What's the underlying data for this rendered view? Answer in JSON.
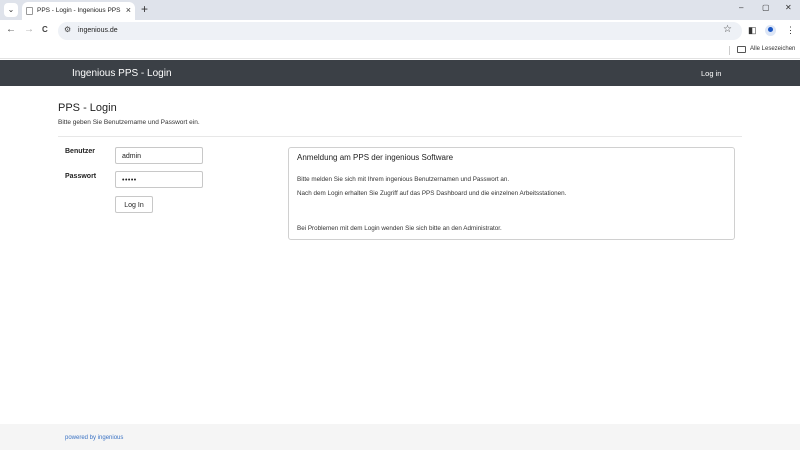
{
  "browser": {
    "tab_title": "PPS - Login - Ingenious PPS",
    "tab_menu_glyph": "⌄",
    "tab_close_glyph": "×",
    "new_tab_glyph": "+",
    "url": "ingenious.de",
    "bookmark_folder_label": "Alle Lesezeichen",
    "icons": {
      "back": "←",
      "forward": "→",
      "reload": "C",
      "site_info": "⚙",
      "star": "☆",
      "sidepanel": "◧",
      "menu": "⋮",
      "minimize": "–",
      "restore": "▢",
      "close": "✕"
    }
  },
  "navbar": {
    "brand": "Ingenious PPS - Login",
    "login_link": "Log in",
    "background": "#3b4046"
  },
  "login": {
    "title": "PPS - Login",
    "subtitle": "Bitte geben Sie Benutzername und Passwort ein.",
    "username_label": "Benutzer",
    "username_value": "admin",
    "password_label": "Passwort",
    "password_value": "•••••",
    "submit_label": "Log In"
  },
  "info": {
    "title": "Anmeldung am PPS der ingenious Software",
    "line1": "Bitte melden Sie sich mit Ihrem ingenious Benutzernamen und Passwort an.",
    "line2": "Nach dem Login erhalten Sie Zugriff auf das PPS Dashboard und die einzelnen Arbeitsstationen.",
    "line3": "Bei Problemen mit dem Login wenden Sie sich bitte an den Administrator."
  },
  "footer": {
    "text": "powered by ingenious",
    "link_color": "#3b73c4"
  }
}
